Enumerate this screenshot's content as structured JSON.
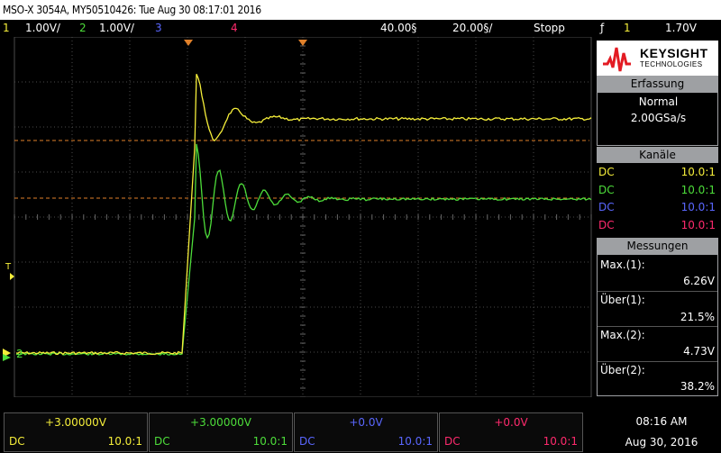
{
  "title": "MSO-X 3054A, MY50510426: Tue Aug 30 08:17:01 2016",
  "status": {
    "ch1_num": "1",
    "ch1_scale": "1.00V/",
    "ch2_num": "2",
    "ch2_scale": "1.00V/",
    "ch3_num": "3",
    "ch4_num": "4",
    "time_delay": "40.00§",
    "time_scale": "20.00§/",
    "run_state": "Stopp",
    "trigger_symbol": "ƒ",
    "trigger_source": "1",
    "trigger_level": "1.70V"
  },
  "logo": {
    "brand": "KEYSIGHT",
    "sub": "TECHNOLOGIES"
  },
  "acquisition": {
    "header": "Erfassung",
    "mode": "Normal",
    "rate": "2.00GSa/s"
  },
  "channels": {
    "header": "Kanäle",
    "rows": [
      {
        "coupling": "DC",
        "probe": "10.0:1",
        "color": "#f5ee3a"
      },
      {
        "coupling": "DC",
        "probe": "10.0:1",
        "color": "#4ddd3a"
      },
      {
        "coupling": "DC",
        "probe": "10.0:1",
        "color": "#5a67ff"
      },
      {
        "coupling": "DC",
        "probe": "10.0:1",
        "color": "#ff2a6d"
      }
    ]
  },
  "measurements": {
    "header": "Messungen",
    "items": [
      {
        "label": "Max.(1):",
        "value": "6.26V"
      },
      {
        "label": "Über(1):",
        "value": "21.5%"
      },
      {
        "label": "Max.(2):",
        "value": "4.73V"
      },
      {
        "label": "Über(2):",
        "value": "38.2%"
      }
    ]
  },
  "footer": [
    {
      "offset": "+3.00000V",
      "coupling": "DC",
      "probe": "10.0:1",
      "color": "#f5ee3a"
    },
    {
      "offset": "+3.00000V",
      "coupling": "DC",
      "probe": "10.0:1",
      "color": "#4ddd3a"
    },
    {
      "offset": "+0.0V",
      "coupling": "DC",
      "probe": "10.0:1",
      "color": "#5a67ff"
    },
    {
      "offset": "+0.0V",
      "coupling": "DC",
      "probe": "10.0:1",
      "color": "#ff2a6d"
    }
  ],
  "clock": {
    "time": "08:16 AM",
    "date": "Aug 30, 2016"
  },
  "screen_markers": {
    "trigger_marker": "T",
    "ch2_marker": "2"
  },
  "colors": {
    "ch1": "#f5ee3a",
    "ch2": "#4ddd3a",
    "ch3": "#5a67ff",
    "ch4": "#ff2a6d",
    "ref_line": "#e0802a",
    "grid": "#555555"
  }
}
